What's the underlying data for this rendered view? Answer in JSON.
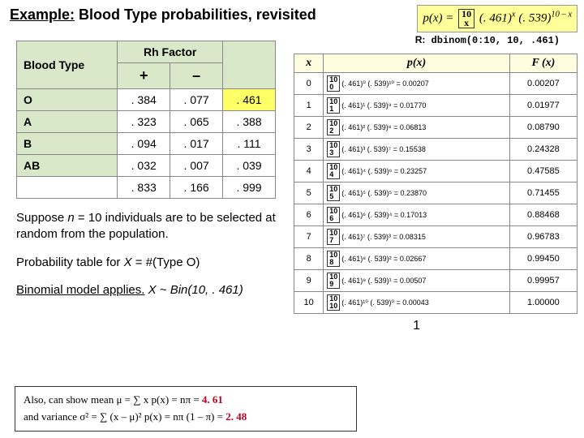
{
  "title": {
    "ex": "Example:",
    "rest": "  Blood Type probabilities, revisited"
  },
  "formula": {
    "lhs": "p(x) = ",
    "n": "10",
    "k": "x",
    "mid": " (. 461)",
    "e1": "x",
    "mid2": " (. 539)",
    "e2": "10 – x"
  },
  "rcode": {
    "lbl": "R:",
    "code": " dbinom(0:10, 10, .461)"
  },
  "btable": {
    "rh": "Rh Factor",
    "bt": "Blood Type",
    "plus": "+",
    "minus": "–",
    "rows": [
      {
        "bt": "O",
        "p": ". 384",
        "m": ". 077",
        "t": ". 461",
        "hl": true
      },
      {
        "bt": "A",
        "p": ". 323",
        "m": ". 065",
        "t": ". 388"
      },
      {
        "bt": "B",
        "p": ". 094",
        "m": ". 017",
        "t": ". 111"
      },
      {
        "bt": "AB",
        "p": ". 032",
        "m": ". 007",
        "t": ". 039"
      }
    ],
    "totals": {
      "p": ". 833",
      "m": ". 166",
      "t": ". 999"
    }
  },
  "para1": {
    "a": "Suppose ",
    "n": "n",
    "b": " = 10 individuals are to be selected at random from the population."
  },
  "para2": {
    "a": "Probability table for ",
    "x": "X",
    "b": " = #(Type O)"
  },
  "para3": {
    "a": "Binomial model applies.",
    "b": "  X ~ Bin(10, . 461)"
  },
  "ptable": {
    "h": {
      "x": "x",
      "px": "p(x)",
      "fx": "F (x)"
    },
    "rows": [
      {
        "x": "0",
        "bn": "10\n0",
        "f": "(. 461)⁰ (. 539)¹⁰ = 0.00207",
        "fx": "0.00207"
      },
      {
        "x": "1",
        "bn": "10\n1",
        "f": "(. 461)¹ (. 539)⁹  = 0.01770",
        "fx": "0.01977"
      },
      {
        "x": "2",
        "bn": "10\n2",
        "f": "(. 461)² (. 539)⁸  = 0.06813",
        "fx": "0.08790"
      },
      {
        "x": "3",
        "bn": "10\n3",
        "f": "(. 461)³ (. 539)⁷  = 0.15538",
        "fx": "0.24328"
      },
      {
        "x": "4",
        "bn": "10\n4",
        "f": "(. 461)⁴ (. 539)⁶  = 0.23257",
        "fx": "0.47585"
      },
      {
        "x": "5",
        "bn": "10\n5",
        "f": "(. 461)⁵ (. 539)⁵  = 0.23870",
        "fx": "0.71455"
      },
      {
        "x": "6",
        "bn": "10\n6",
        "f": "(. 461)⁶ (. 539)⁴  = 0.17013",
        "fx": "0.88468"
      },
      {
        "x": "7",
        "bn": "10\n7",
        "f": "(. 461)⁷ (. 539)³  = 0.08315",
        "fx": "0.96783"
      },
      {
        "x": "8",
        "bn": "10\n8",
        "f": "(. 461)⁸ (. 539)²  = 0.02667",
        "fx": "0.99450"
      },
      {
        "x": "9",
        "bn": "10\n9",
        "f": "(. 461)⁹ (. 539)¹  = 0.00507",
        "fx": "0.99957"
      },
      {
        "x": "10",
        "bn": "10\n10",
        "f": "(. 461)¹⁰ (. 539)⁰ = 0.00043",
        "fx": "1.00000"
      }
    ],
    "sum": "1"
  },
  "meanbox": {
    "l1a": "Also, can show mean μ = ∑ x p(x) =  nπ  = ",
    "v1": "4. 61",
    "l2a": "and variance σ² = ∑ (x – μ)² p(x) =  nπ (1 – π)  = ",
    "v2": "2. 48"
  }
}
